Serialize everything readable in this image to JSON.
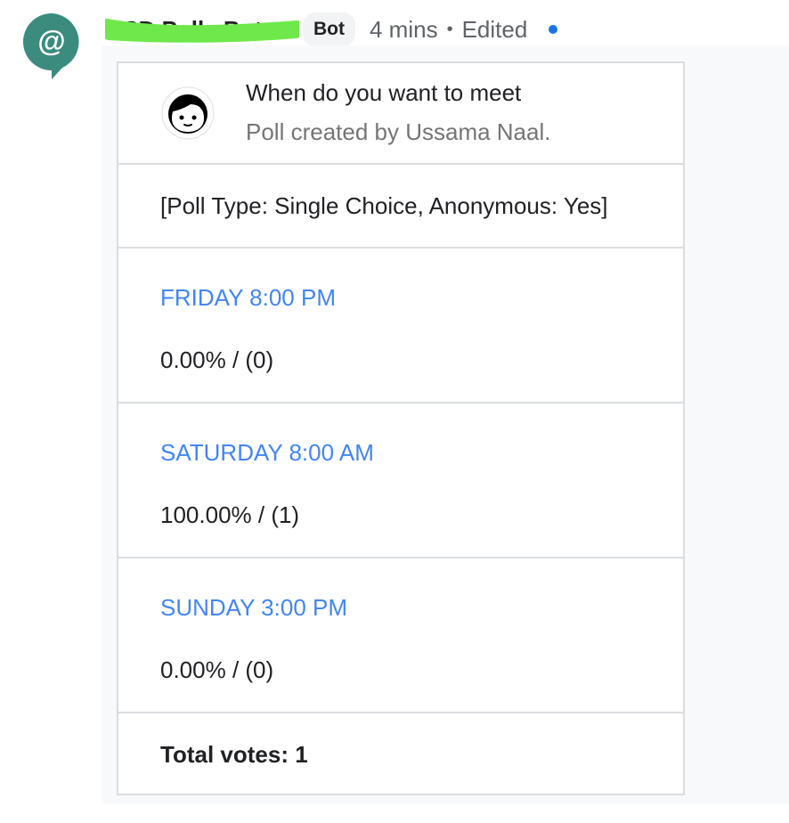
{
  "message": {
    "sender_name": "GSD Polls Bot",
    "badge": "Bot",
    "time": "4 mins",
    "separator": "•",
    "edited": "Edited",
    "avatar_icon": "at-sign-icon",
    "avatar_color": "#3b8c7e",
    "unread_color": "#1a73e8"
  },
  "poll": {
    "title": "When do you want to meet",
    "subtitle": "Poll created by Ussama Naal.",
    "creator_icon": "face-icon",
    "info": "[Poll Type: Single Choice, Anonymous: Yes]",
    "options": [
      {
        "label": "FRIDAY 8:00 PM",
        "result": "0.00% / (0)"
      },
      {
        "label": "SATURDAY 8:00 AM",
        "result": "100.00% / (1)"
      },
      {
        "label": "SUNDAY 3:00 PM",
        "result": "0.00% / (0)"
      }
    ],
    "total": "Total votes: 1",
    "option_color": "#4285f4"
  }
}
